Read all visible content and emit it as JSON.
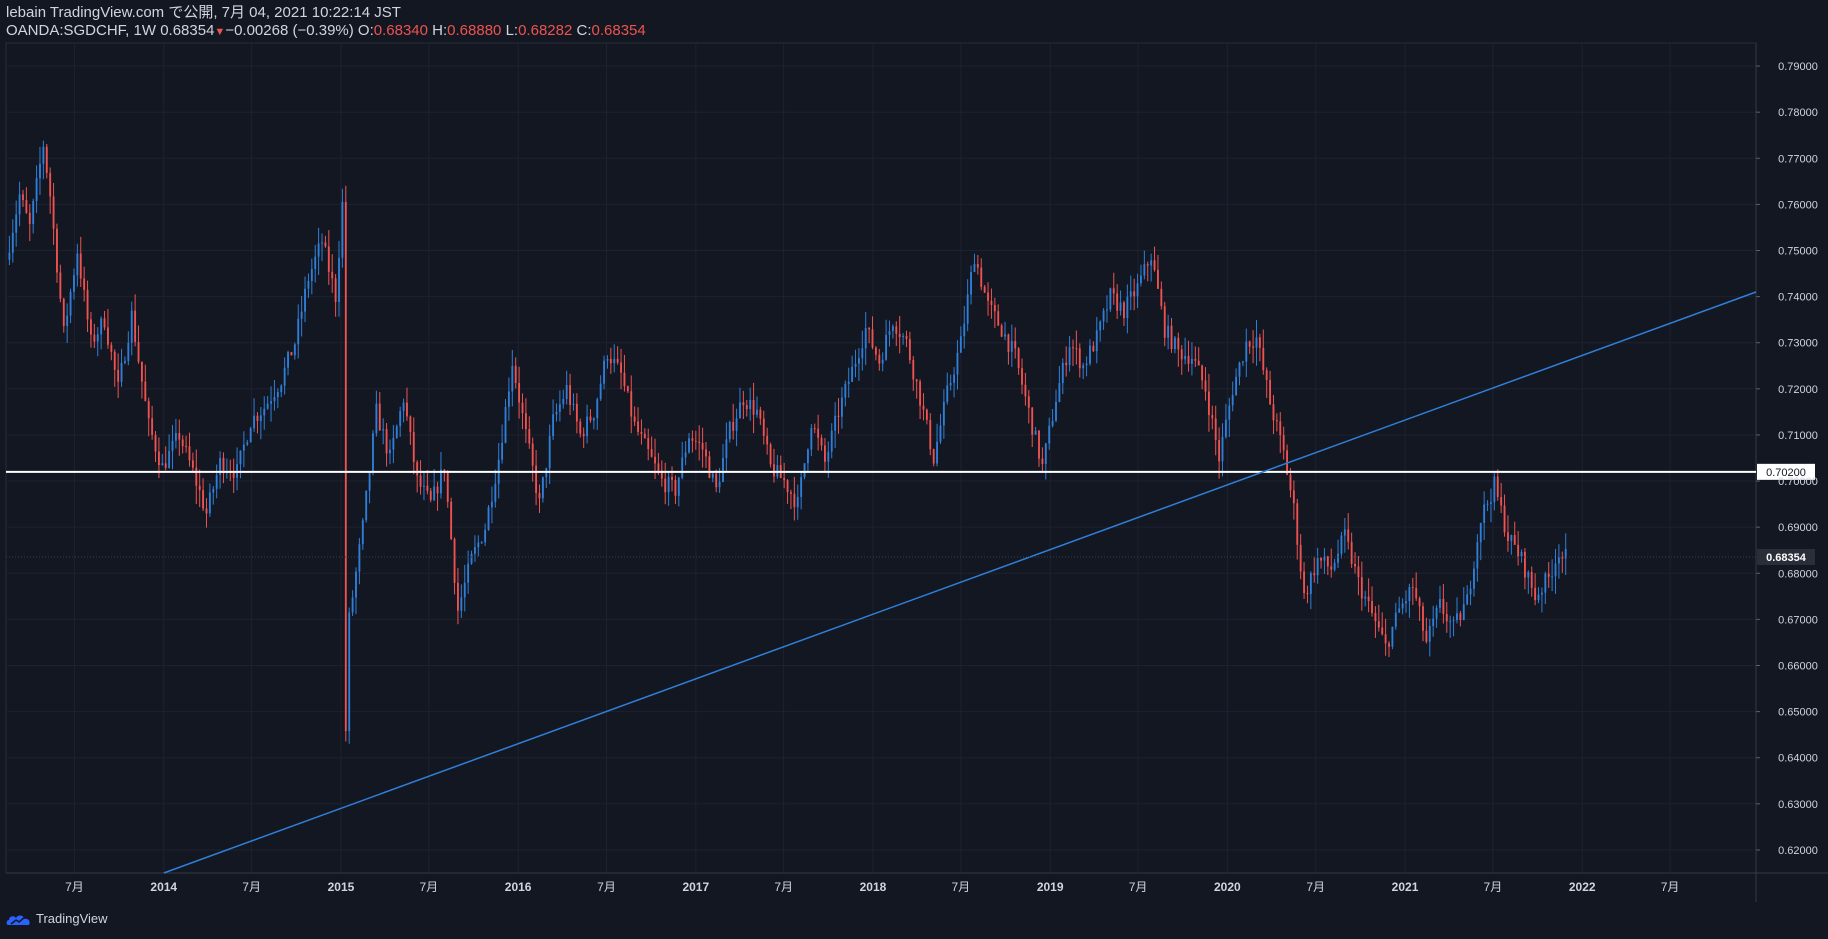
{
  "header": {
    "publish_line": "lebain TradingView.com で公開, 7月 04, 2021 10:22:14 JST",
    "symbol": "OANDA:SGDCHF, 1W",
    "last": "0.68354",
    "change": "−0.00268 (−0.39%)",
    "o_label": "O:",
    "o_value": "0.68340",
    "h_label": "H:",
    "h_value": "0.68880",
    "l_label": "L:",
    "l_value": "0.68282",
    "c_label": "C:",
    "c_value": "0.68354"
  },
  "footer": {
    "brand": "TradingView",
    "logo_icon": "tradingview-cloud-icon"
  },
  "colors": {
    "background": "#131722",
    "up": "#2f7fd8",
    "down": "#ef5350",
    "trendline": "#2f7fd8",
    "hline": "#ffffff",
    "grid": "#1e2230"
  },
  "chart_data": {
    "type": "candlestick",
    "symbol": "OANDA:SGDCHF",
    "interval": "1W",
    "ylim": [
      0.615,
      0.795
    ],
    "y_ticks": [
      "0.62000",
      "0.63000",
      "0.64000",
      "0.65000",
      "0.66000",
      "0.67000",
      "0.68000",
      "0.69000",
      "0.70000",
      "0.71000",
      "0.72000",
      "0.73000",
      "0.74000",
      "0.75000",
      "0.76000",
      "0.77000",
      "0.78000",
      "0.79000"
    ],
    "x_range": [
      "2013-02-10",
      "2022-12-25"
    ],
    "x_ticks": [
      {
        "label": "7月",
        "date": "2013-07-01"
      },
      {
        "label": "2014",
        "date": "2014-01-01"
      },
      {
        "label": "7月",
        "date": "2014-07-01"
      },
      {
        "label": "2015",
        "date": "2015-01-01"
      },
      {
        "label": "7月",
        "date": "2015-07-01"
      },
      {
        "label": "2016",
        "date": "2016-01-01"
      },
      {
        "label": "7月",
        "date": "2016-07-01"
      },
      {
        "label": "2017",
        "date": "2017-01-01"
      },
      {
        "label": "7月",
        "date": "2017-07-01"
      },
      {
        "label": "2018",
        "date": "2018-01-01"
      },
      {
        "label": "7月",
        "date": "2018-07-01"
      },
      {
        "label": "2019",
        "date": "2019-01-01"
      },
      {
        "label": "7月",
        "date": "2019-07-01"
      },
      {
        "label": "2020",
        "date": "2020-01-01"
      },
      {
        "label": "7月",
        "date": "2020-07-01"
      },
      {
        "label": "2021",
        "date": "2021-01-01"
      },
      {
        "label": "7月",
        "date": "2021-07-01"
      },
      {
        "label": "2022",
        "date": "2022-01-01"
      },
      {
        "label": "7月",
        "date": "2022-07-01"
      }
    ],
    "price_path": [
      [
        "2013-02-17",
        0.748
      ],
      [
        "2013-03-17",
        0.762
      ],
      [
        "2013-04-07",
        0.755
      ],
      [
        "2013-05-05",
        0.773
      ],
      [
        "2013-05-19",
        0.762
      ],
      [
        "2013-06-16",
        0.732
      ],
      [
        "2013-07-14",
        0.75
      ],
      [
        "2013-08-11",
        0.73
      ],
      [
        "2013-09-08",
        0.735
      ],
      [
        "2013-10-06",
        0.72
      ],
      [
        "2013-11-03",
        0.736
      ],
      [
        "2013-12-08",
        0.712
      ],
      [
        "2014-01-05",
        0.703
      ],
      [
        "2014-02-09",
        0.71
      ],
      [
        "2014-03-09",
        0.702
      ],
      [
        "2014-04-06",
        0.693
      ],
      [
        "2014-05-04",
        0.704
      ],
      [
        "2014-06-08",
        0.702
      ],
      [
        "2014-07-06",
        0.713
      ],
      [
        "2014-08-03",
        0.716
      ],
      [
        "2014-09-07",
        0.722
      ],
      [
        "2014-10-05",
        0.73
      ],
      [
        "2014-11-02",
        0.744
      ],
      [
        "2014-11-30",
        0.752
      ],
      [
        "2014-12-28",
        0.74
      ],
      [
        "2015-01-11",
        0.76
      ],
      [
        "2015-01-18",
        0.646
      ],
      [
        "2015-01-25",
        0.67
      ],
      [
        "2015-02-22",
        0.69
      ],
      [
        "2015-03-22",
        0.715
      ],
      [
        "2015-04-19",
        0.705
      ],
      [
        "2015-05-17",
        0.718
      ],
      [
        "2015-06-14",
        0.7
      ],
      [
        "2015-07-12",
        0.695
      ],
      [
        "2015-08-09",
        0.703
      ],
      [
        "2015-09-06",
        0.672
      ],
      [
        "2015-10-04",
        0.683
      ],
      [
        "2015-11-01",
        0.69
      ],
      [
        "2015-11-29",
        0.705
      ],
      [
        "2015-12-27",
        0.726
      ],
      [
        "2016-01-24",
        0.71
      ],
      [
        "2016-02-21",
        0.695
      ],
      [
        "2016-03-20",
        0.713
      ],
      [
        "2016-04-17",
        0.72
      ],
      [
        "2016-05-15",
        0.71
      ],
      [
        "2016-06-12",
        0.715
      ],
      [
        "2016-07-10",
        0.728
      ],
      [
        "2016-08-07",
        0.723
      ],
      [
        "2016-09-04",
        0.712
      ],
      [
        "2016-10-02",
        0.706
      ],
      [
        "2016-10-30",
        0.7
      ],
      [
        "2016-11-27",
        0.698
      ],
      [
        "2016-12-25",
        0.71
      ],
      [
        "2017-01-22",
        0.707
      ],
      [
        "2017-02-19",
        0.698
      ],
      [
        "2017-03-19",
        0.711
      ],
      [
        "2017-04-16",
        0.718
      ],
      [
        "2017-05-14",
        0.715
      ],
      [
        "2017-06-11",
        0.703
      ],
      [
        "2017-07-09",
        0.7
      ],
      [
        "2017-08-06",
        0.695
      ],
      [
        "2017-09-03",
        0.713
      ],
      [
        "2017-10-01",
        0.704
      ],
      [
        "2017-10-29",
        0.715
      ],
      [
        "2017-11-26",
        0.724
      ],
      [
        "2017-12-24",
        0.733
      ],
      [
        "2018-01-21",
        0.726
      ],
      [
        "2018-02-18",
        0.735
      ],
      [
        "2018-03-18",
        0.73
      ],
      [
        "2018-04-15",
        0.718
      ],
      [
        "2018-05-13",
        0.705
      ],
      [
        "2018-06-10",
        0.719
      ],
      [
        "2018-07-08",
        0.73
      ],
      [
        "2018-08-05",
        0.749
      ],
      [
        "2018-09-02",
        0.738
      ],
      [
        "2018-09-30",
        0.733
      ],
      [
        "2018-10-28",
        0.727
      ],
      [
        "2018-11-25",
        0.715
      ],
      [
        "2018-12-23",
        0.703
      ],
      [
        "2019-01-20",
        0.718
      ],
      [
        "2019-02-17",
        0.73
      ],
      [
        "2019-03-17",
        0.725
      ],
      [
        "2019-04-14",
        0.731
      ],
      [
        "2019-05-12",
        0.74
      ],
      [
        "2019-06-09",
        0.737
      ],
      [
        "2019-07-07",
        0.742
      ],
      [
        "2019-08-04",
        0.749
      ],
      [
        "2019-09-01",
        0.733
      ],
      [
        "2019-09-29",
        0.728
      ],
      [
        "2019-10-27",
        0.727
      ],
      [
        "2019-11-24",
        0.72
      ],
      [
        "2019-12-22",
        0.705
      ],
      [
        "2020-01-19",
        0.72
      ],
      [
        "2020-02-16",
        0.73
      ],
      [
        "2020-03-08",
        0.731
      ],
      [
        "2020-04-05",
        0.717
      ],
      [
        "2020-05-03",
        0.706
      ],
      [
        "2020-05-24",
        0.694
      ],
      [
        "2020-06-14",
        0.675
      ],
      [
        "2020-07-12",
        0.683
      ],
      [
        "2020-08-09",
        0.681
      ],
      [
        "2020-09-06",
        0.688
      ],
      [
        "2020-10-04",
        0.678
      ],
      [
        "2020-11-01",
        0.671
      ],
      [
        "2020-11-29",
        0.664
      ],
      [
        "2020-12-27",
        0.672
      ],
      [
        "2021-01-24",
        0.677
      ],
      [
        "2021-02-21",
        0.665
      ],
      [
        "2021-03-21",
        0.673
      ],
      [
        "2021-04-18",
        0.668
      ],
      [
        "2021-05-16",
        0.674
      ],
      [
        "2021-06-13",
        0.692
      ],
      [
        "2021-07-11",
        0.699
      ],
      [
        "2021-08-08",
        0.688
      ],
      [
        "2021-09-05",
        0.683
      ],
      [
        "2021-10-03",
        0.675
      ],
      [
        "2021-10-31",
        0.679
      ],
      [
        "2021-11-21",
        0.685
      ],
      [
        "2021-11-28",
        0.6835
      ]
    ],
    "annotations": [
      {
        "type": "horizontal-line",
        "price": 0.702,
        "label": "0.70200"
      },
      {
        "type": "trend-line",
        "from": [
          "2014-01-01",
          0.615
        ],
        "to": [
          "2022-12-25",
          0.741
        ]
      },
      {
        "type": "last-price",
        "price": 0.68354,
        "label": "0.68354"
      }
    ]
  }
}
